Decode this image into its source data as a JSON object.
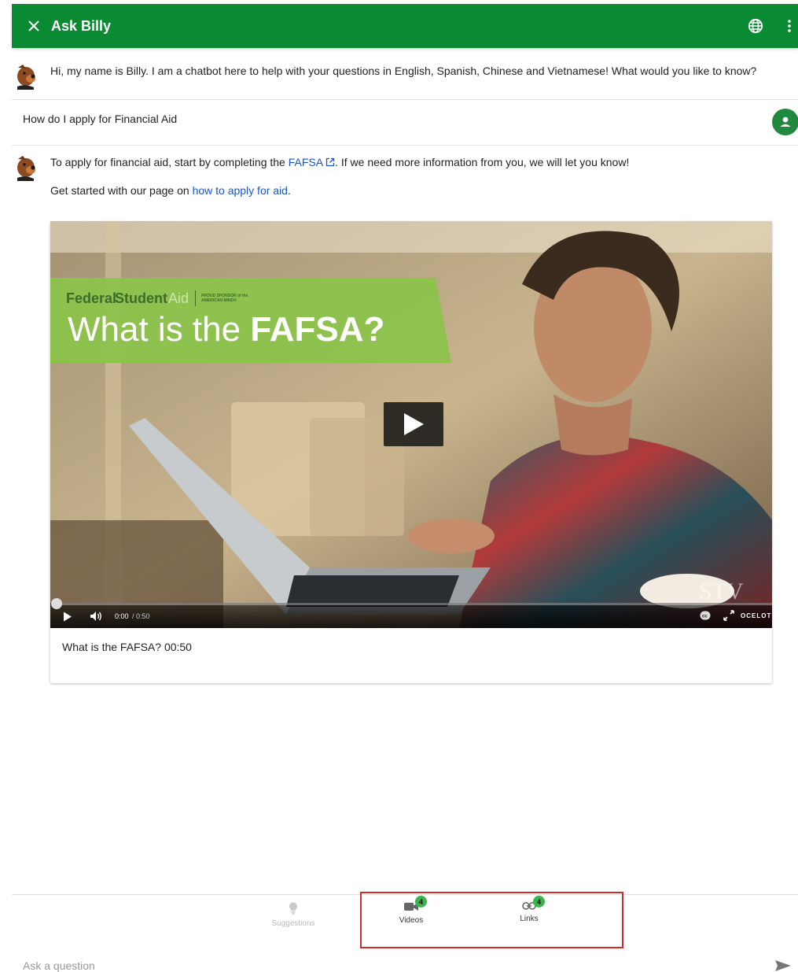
{
  "header": {
    "title": "Ask Billy"
  },
  "messages": {
    "bot_greeting": "Hi, my name is Billy. I am a chatbot here to help with your questions in English, Spanish, Chinese and Vietnamese! What would you like to know?",
    "user_question": "How do I apply for Financial Aid",
    "bot_reply_prefix": "To apply for financial aid, start by completing the ",
    "bot_reply_link": "FAFSA",
    "bot_reply_suffix": ". If we need more information from you, we will let you know!",
    "bot_followup_prefix": "Get started with our page on ",
    "bot_followup_link": "how to apply for aid",
    "bot_followup_suffix": "."
  },
  "video": {
    "banner_brand_federal": "Federal",
    "banner_brand_student": "Student",
    "banner_brand_aid": "Aid",
    "banner_sponsor": "PROUD SPONSOR of the AMERICAN MIND®",
    "banner_title_prefix": "What is the ",
    "banner_title_bold": "FAFSA?",
    "time_current": "0:00",
    "time_total": "/ 0:50",
    "watermark": "STV",
    "brand": "OCELOT",
    "progress": 0.0,
    "caption": "What is the FAFSA? 00:50"
  },
  "tabs": [
    {
      "label": "Suggestions",
      "icon": "lightbulb-icon",
      "enabled": false
    },
    {
      "label": "Videos",
      "icon": "video-camera-icon",
      "badge": "4",
      "enabled": true
    },
    {
      "label": "Links",
      "icon": "link-icon",
      "badge": "4",
      "enabled": true
    }
  ],
  "composer": {
    "placeholder": "Ask a question"
  },
  "colors": {
    "header": "#0b8a34",
    "badge": "#3bb34a",
    "link": "#1a56c9",
    "highlight": "#c9302c"
  }
}
